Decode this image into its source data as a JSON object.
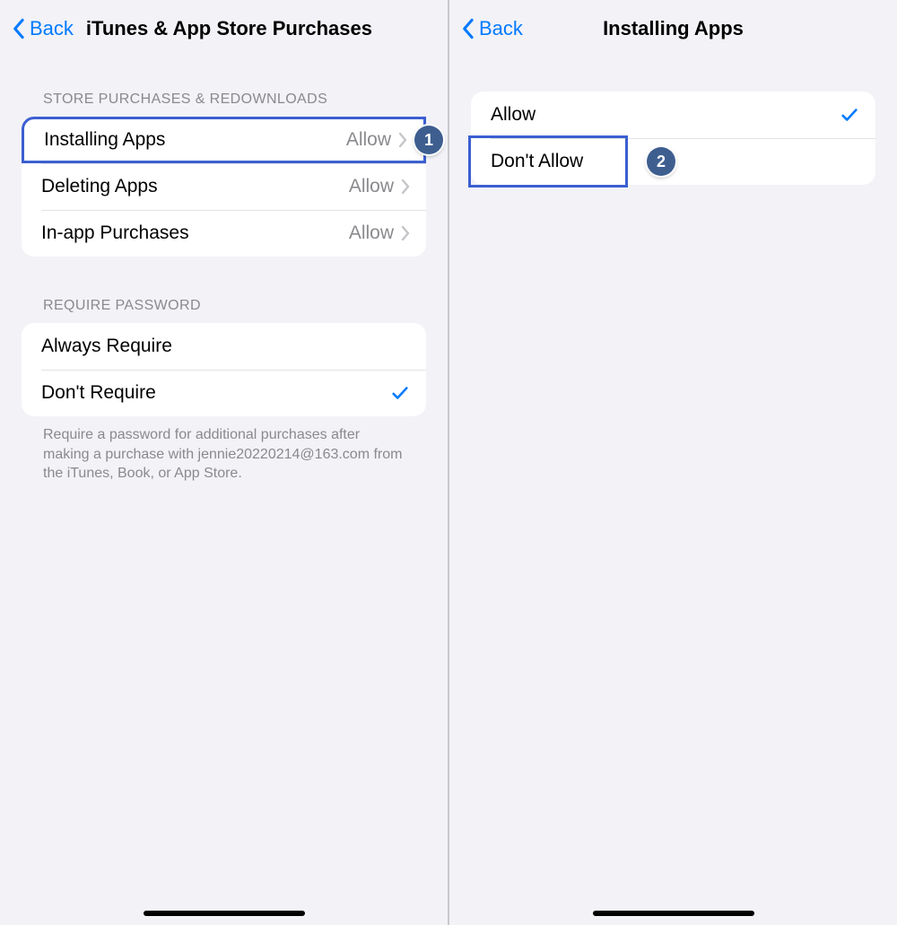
{
  "left": {
    "back_label": "Back",
    "title": "iTunes & App Store Purchases",
    "section1_header": "STORE PURCHASES & REDOWNLOADS",
    "rows1": [
      {
        "label": "Installing Apps",
        "value": "Allow"
      },
      {
        "label": "Deleting Apps",
        "value": "Allow"
      },
      {
        "label": "In-app Purchases",
        "value": "Allow"
      }
    ],
    "section2_header": "REQUIRE PASSWORD",
    "rows2": [
      {
        "label": "Always Require",
        "checked": false
      },
      {
        "label": "Don't Require",
        "checked": true
      }
    ],
    "footer": "Require a password for additional purchases after making a purchase with jennie20220214@163.com from the iTunes, Book, or App Store.",
    "callout": "1"
  },
  "right": {
    "back_label": "Back",
    "title": "Installing Apps",
    "rows": [
      {
        "label": "Allow",
        "checked": true
      },
      {
        "label": "Don't Allow",
        "checked": false
      }
    ],
    "callout": "2"
  }
}
